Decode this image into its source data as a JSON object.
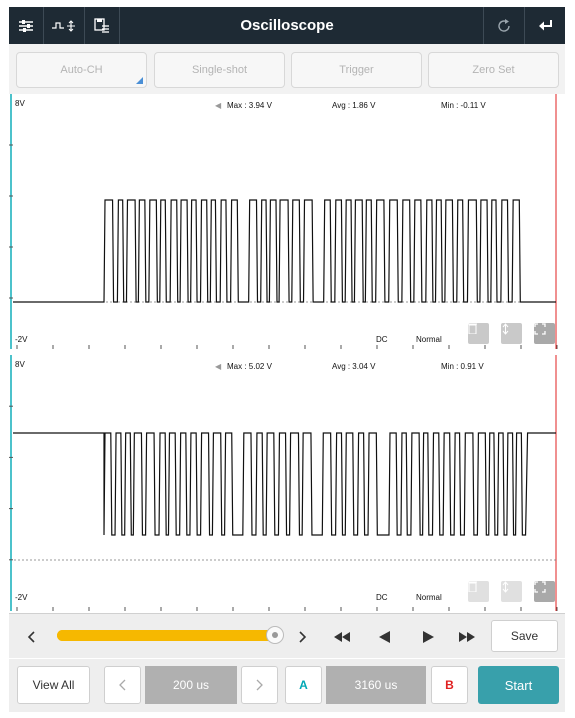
{
  "title": "Oscilloscope",
  "toolbar": {
    "left_icons": [
      "settings-sliders-icon",
      "waveform-toggle-icon",
      "save-list-icon"
    ],
    "right_icons": [
      "refresh-icon",
      "back-arrow-icon"
    ]
  },
  "top_buttons": [
    "Auto-CH",
    "Single-shot",
    "Trigger",
    "Zero Set"
  ],
  "channels": [
    {
      "top_label": "8V",
      "bottom_label": "-2V",
      "max": "Max : 3.94 V",
      "avg": "Avg : 1.86 V",
      "min": "Min : -0.11 V",
      "coupling": "DC",
      "mode": "Normal"
    },
    {
      "top_label": "8V",
      "bottom_label": "-2V",
      "max": "Max : 5.02 V",
      "avg": "Avg : 3.04 V",
      "min": "Min : 0.91 V",
      "coupling": "DC",
      "mode": "Normal"
    }
  ],
  "transport": {
    "progress": 1.0,
    "save_label": "Save",
    "icons": [
      "chevron-left-icon",
      "chevron-right-icon",
      "rewind-icon",
      "step-back-icon",
      "step-forward-icon",
      "fast-forward-icon"
    ]
  },
  "bottom": {
    "view_all": "View All",
    "timebase": "200 us",
    "cursor_a": "A",
    "cursor_delta": "3160 us",
    "cursor_b": "B",
    "start": "Start"
  },
  "colors": {
    "titlebar": "#1e2a34",
    "accent": "#f6b800",
    "start": "#38a0ab",
    "cursor_a": "#00a8b5",
    "cursor_b": "#e02020"
  }
}
